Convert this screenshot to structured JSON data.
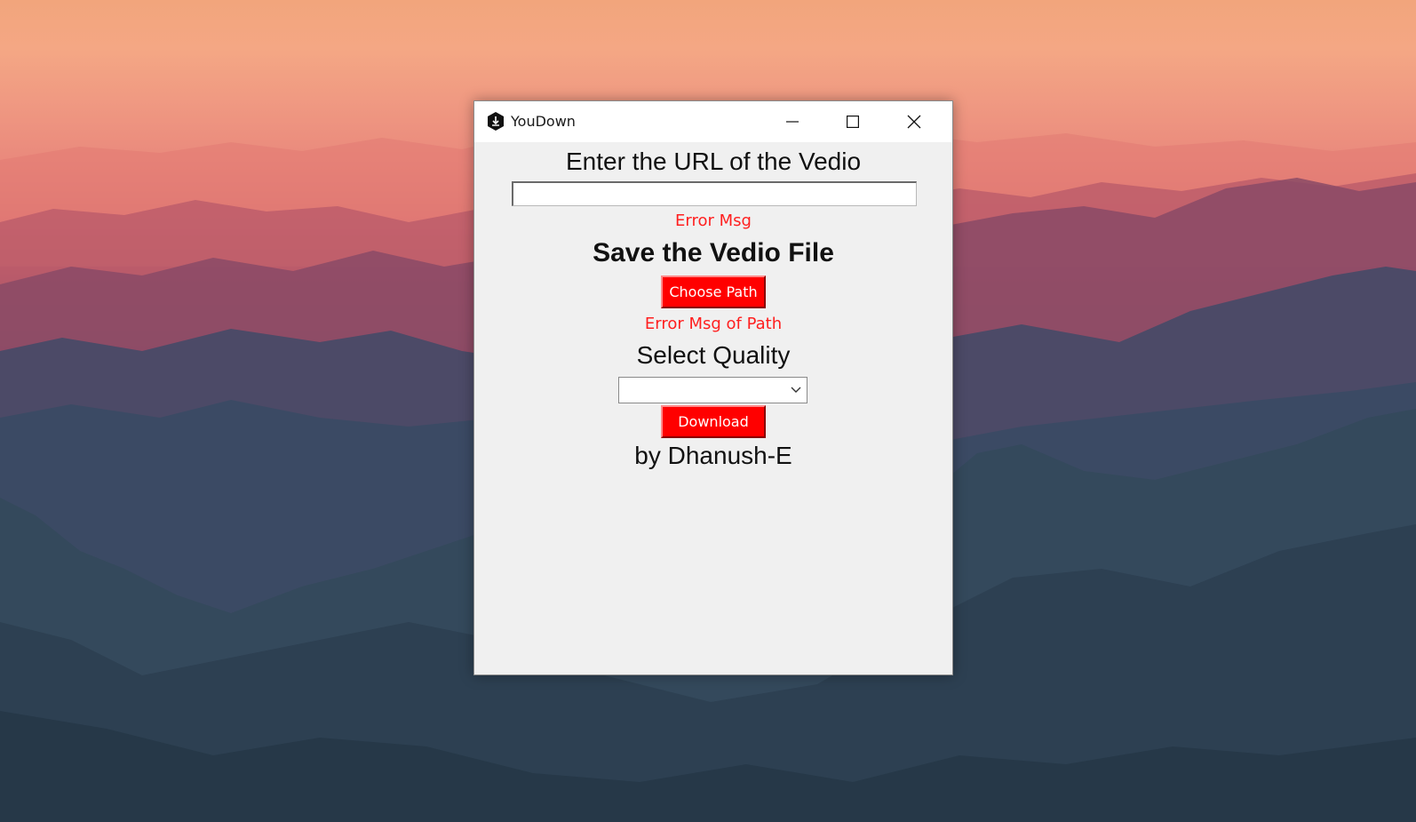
{
  "window": {
    "title": "YouDown"
  },
  "titlebar": {
    "icons": [
      "download-app-icon",
      "minimize-icon",
      "maximize-icon",
      "close-icon"
    ]
  },
  "form": {
    "url_heading": "Enter the URL of the Vedio",
    "url_value": "",
    "url_error": "Error Msg",
    "save_heading": "Save the Vedio File",
    "choose_path_label": "Choose Path",
    "path_error": "Error Msg of Path",
    "quality_heading": "Select Quality",
    "quality_selected": "",
    "download_label": "Download",
    "credit": "by Dhanush-E"
  },
  "colors": {
    "accent_button": "#ff0000",
    "error_text": "#ff1f1f",
    "window_bg": "#f0f0f0"
  }
}
